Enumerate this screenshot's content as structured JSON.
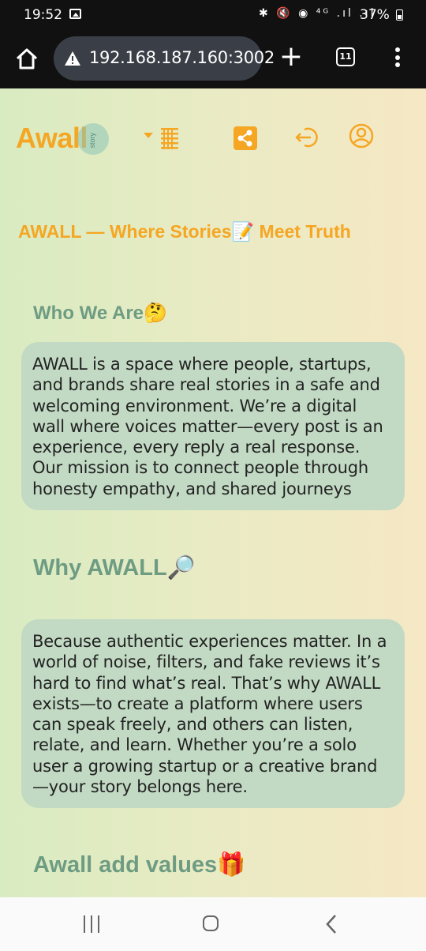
{
  "status_bar": {
    "time": "19:52",
    "system_icons": "✱ 🔇 ◉ ⁴ᴳ .ıl .ıl",
    "battery": "37%"
  },
  "browser": {
    "url": "192.168.187.160:3002",
    "new_tab": "+",
    "tab_count": "11"
  },
  "header": {
    "logo_text": "Awall",
    "logo_sub": "story",
    "brand_color": "#f5a623",
    "icons": [
      "menu-icon",
      "share-icon",
      "logout-icon",
      "profile-icon"
    ]
  },
  "content": {
    "headline": "AWALL — Where Stories📝 Meet Truth",
    "sections": [
      {
        "title": "Who We Are🤔",
        "text": "AWALL is a space where people, startups, and brands share real stories in a safe and welcoming environment. We’re a digital wall where voices matter—every post is an experience, every reply a real response. Our mission is to connect people through honesty empathy, and shared journeys"
      },
      {
        "title": "Why AWALL🔎",
        "text": "Because authentic experiences matter. In a world of noise, filters, and fake reviews it’s hard to find what’s real. That’s why AWALL exists—to create a platform where users can speak freely, and others can listen, relate, and learn. Whether you’re a solo user a growing startup or a creative brand —your story belongs here."
      },
      {
        "title": "Awall add values🎁"
      }
    ]
  },
  "colors": {
    "accent": "#f5a623",
    "section_title": "#6e9c83",
    "card_bg": "#c2dac4"
  }
}
